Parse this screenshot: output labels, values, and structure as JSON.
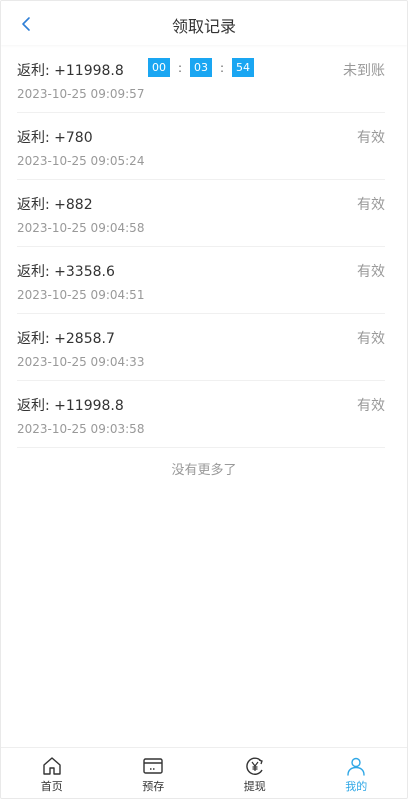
{
  "header": {
    "title": "领取记录",
    "back_icon": "chevron-left-icon"
  },
  "records": [
    {
      "amount": "返利: +11998.8",
      "time": "2023-10-25 09:09:57",
      "status": "未到账",
      "countdown": [
        "00",
        "03",
        "54"
      ]
    },
    {
      "amount": "返利: +780",
      "time": "2023-10-25 09:05:24",
      "status": "有效"
    },
    {
      "amount": "返利: +882",
      "time": "2023-10-25 09:04:58",
      "status": "有效"
    },
    {
      "amount": "返利: +3358.6",
      "time": "2023-10-25 09:04:51",
      "status": "有效"
    },
    {
      "amount": "返利: +2858.7",
      "time": "2023-10-25 09:04:33",
      "status": "有效"
    },
    {
      "amount": "返利: +11998.8",
      "time": "2023-10-25 09:03:58",
      "status": "有效"
    }
  ],
  "countdown_separator": ":",
  "no_more": "没有更多了",
  "tabbar": {
    "items": [
      {
        "label": "首页",
        "icon": "home-icon"
      },
      {
        "label": "预存",
        "icon": "card-icon"
      },
      {
        "label": "提现",
        "icon": "yuan-withdraw-icon"
      },
      {
        "label": "我的",
        "icon": "user-icon"
      }
    ],
    "active_index": 3
  },
  "colors": {
    "accent": "#2fa7e6",
    "countdown_bg": "#1aa6f2"
  }
}
